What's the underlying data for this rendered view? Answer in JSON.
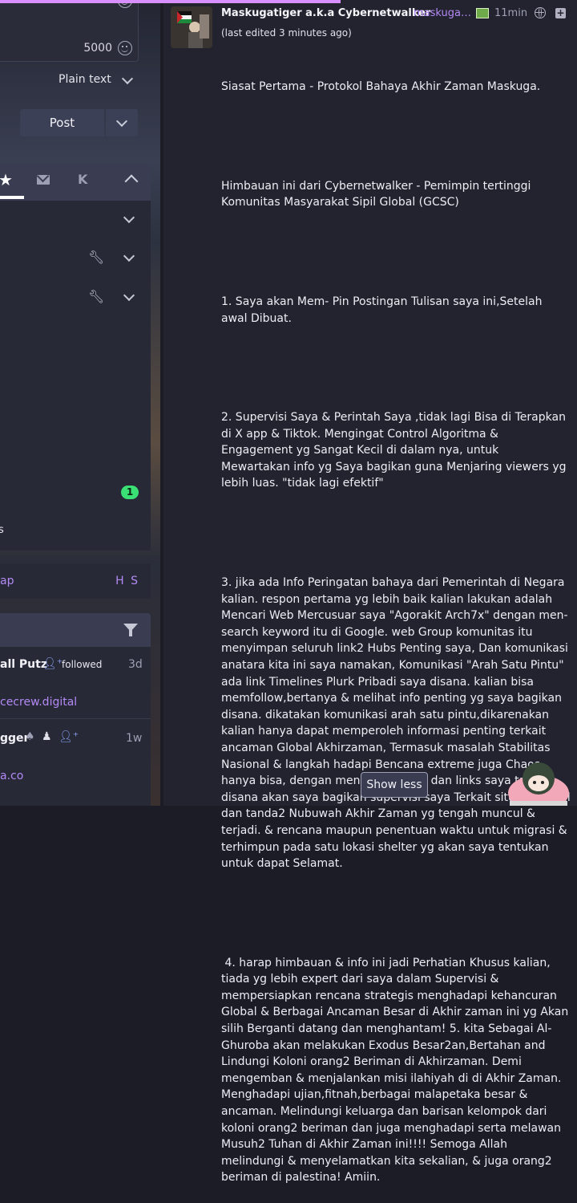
{
  "composer": {
    "char_count": "5000",
    "format_label": "Plain text",
    "post_label": "Post"
  },
  "nav_tabs": {
    "k_label": "K"
  },
  "nav": {
    "badge_count": "1",
    "tail_text": "s"
  },
  "row_link": {
    "left_text": "ap",
    "right_text": "H S"
  },
  "notifications": [
    {
      "name": "all Putz",
      "action": "followed",
      "time": "3d",
      "link": "cecrew.digital"
    },
    {
      "name": "gger",
      "time": "1w",
      "link": "a.co"
    }
  ],
  "status": {
    "display_name": "Maskugatiger a.k.a Cybernetwalker",
    "account": "maskuga…",
    "time": "11min",
    "edited": "(last edited 3 minutes ago)",
    "paragraphs": [
      "Siasat Pertama - Protokol Bahaya Akhir Zaman Maskuga.",
      "Himbauan ini dari Cybernetwalker - Pemimpin tertinggi Komunitas Masyarakat Sipil Global (GCSC)",
      "1. Saya akan Mem- Pin Postingan Tulisan saya ini,Setelah awal Dibuat.",
      "2. Supervisi Saya & Perintah Saya ,tidak lagi Bisa di Terapkan di X app & Tiktok. Mengingat Control Algoritma & Engagement yg Sangat Kecil di dalam nya, untuk Mewartakan info yg Saya bagikan guna Menjaring viewers yg lebih luas. \"tidak lagi efektif\"",
      "3. jika ada Info Peringatan bahaya dari Pemerintah di Negara kalian. respon pertama yg lebih baik kalian lakukan adalah Mencari Web Mercusuar saya \"Agorakit Arch7x\" dengan men-search keyword itu di Google. web Group komunitas itu menyimpan seluruh link2 Hubs Penting saya, Dan komunikasi anatara kita ini saya namakan, Komunikasi \"Arah Satu Pintu\" ada link Timelines Plurk Pribadi saya disana. kalian bisa memfollow,bertanya & melihat info penting yg saya bagikan disana. dikatakan komunikasi arah satu pintu,dikarenakan kalian hanya dapat memperoleh informasi penting terkait ancaman Global Akhirzaman, Termasuk masalah Stabilitas Nasional & langkah hadapi Bencana extreme juga Chaos. hanya bisa, dengan mengakses Web dan links saya tadi. disana akan saya bagikan supervisi saya Terkait situasi Global dan tanda2 Nubuwah Akhir Zaman yg tengah muncul & terjadi. & rencana maupun penentuan waktu untuk migrasi & terhimpun pada satu lokasi shelter yg akan saya tentukan untuk dapat Selamat.",
      " 4. harap himbauan & info ini jadi Perhatian Khusus kalian, tiada yg lebih expert dari saya dalam Supervisi & mempersiapkan rencana strategis menghadapi kehancuran Global & Berbagai Ancaman Besar di Akhir zaman ini yg Akan silih Berganti datang dan menghantam! 5. kita Sebagai Al-Ghuroba akan melakukan Exodus Besar2an,Bertahan and Lindungi Koloni orang2 Beriman di Akhirzaman. Demi mengemban & menjalankan misi ilahiyah di di Akhir Zaman. Menghadapi ujian,fitnah,berbagai malapetaka besar & ancaman. Melindungi keluarga dan barisan kelompok dari koloni orang2 beriman dan juga menghadapi serta melawan Musuh2 Tuhan di Akhir Zaman ini!!!! Semoga Allah melindungi & menyelamatkan kita sekalian, & juga orang2 beriman di palestina! Amiin."
    ],
    "show_less_label": "Show less"
  },
  "colors": {
    "accent_purple": "#b38af5",
    "badge_green": "#3be075",
    "progress_bar": "#d88fff"
  }
}
